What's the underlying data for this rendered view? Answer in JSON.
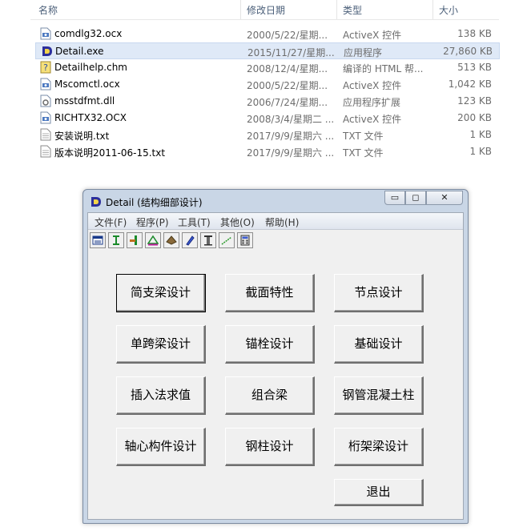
{
  "explorer": {
    "columns": {
      "name": "名称",
      "date": "修改日期",
      "type": "类型",
      "size": "大小"
    },
    "files": [
      {
        "name": "comdlg32.ocx",
        "date": "2000/5/22/星期...",
        "type": "ActiveX 控件",
        "size": "138 KB",
        "icon": "ocx-file-icon"
      },
      {
        "name": "Detail.exe",
        "date": "2015/11/27/星期...",
        "type": "应用程序",
        "size": "27,860 KB",
        "icon": "detail-app-icon"
      },
      {
        "name": "Detailhelp.chm",
        "date": "2008/12/4/星期...",
        "type": "编译的 HTML 帮...",
        "size": "513 KB",
        "icon": "help-file-icon"
      },
      {
        "name": "Mscomctl.ocx",
        "date": "2000/5/22/星期...",
        "type": "ActiveX 控件",
        "size": "1,042 KB",
        "icon": "ocx-file-icon"
      },
      {
        "name": "msstdfmt.dll",
        "date": "2006/7/24/星期...",
        "type": "应用程序扩展",
        "size": "123 KB",
        "icon": "dll-file-icon"
      },
      {
        "name": "RICHTX32.OCX",
        "date": "2008/3/4/星期二 ...",
        "type": "ActiveX 控件",
        "size": "200 KB",
        "icon": "ocx-file-icon"
      },
      {
        "name": "安装说明.txt",
        "date": "2017/9/9/星期六 ...",
        "type": "TXT 文件",
        "size": "1 KB",
        "icon": "text-file-icon"
      },
      {
        "name": "版本说明2011-06-15.txt",
        "date": "2017/9/9/星期六 ...",
        "type": "TXT 文件",
        "size": "1 KB",
        "icon": "text-file-icon"
      }
    ]
  },
  "window": {
    "title": "Detail (结构细部设计)",
    "controls": {
      "minimize": "▭",
      "maximize": "◻",
      "close": "✕"
    },
    "menu": [
      "文件(F)",
      "程序(P)",
      "工具(T)",
      "其他(O)",
      "帮助(H)"
    ],
    "toolbar_icons": [
      "form-icon",
      "i-beam-icon",
      "column-joint-icon",
      "truss-icon",
      "footing-icon",
      "pen-icon",
      "steel-column-icon",
      "ruler-icon",
      "calculator-icon"
    ],
    "buttons": [
      [
        "简支梁设计",
        "截面特性",
        "节点设计"
      ],
      [
        "单跨梁设计",
        "锚栓设计",
        "基础设计"
      ],
      [
        "插入法求值",
        "组合梁",
        "钢管混凝土柱"
      ],
      [
        "轴心构件设计",
        "钢柱设计",
        "桁架梁设计"
      ]
    ],
    "exit_label": "退出"
  },
  "colors": {
    "selected_row": "#dfe9f7",
    "window_frame": "#c9d6e6",
    "client_bg": "#f0f0f0"
  }
}
